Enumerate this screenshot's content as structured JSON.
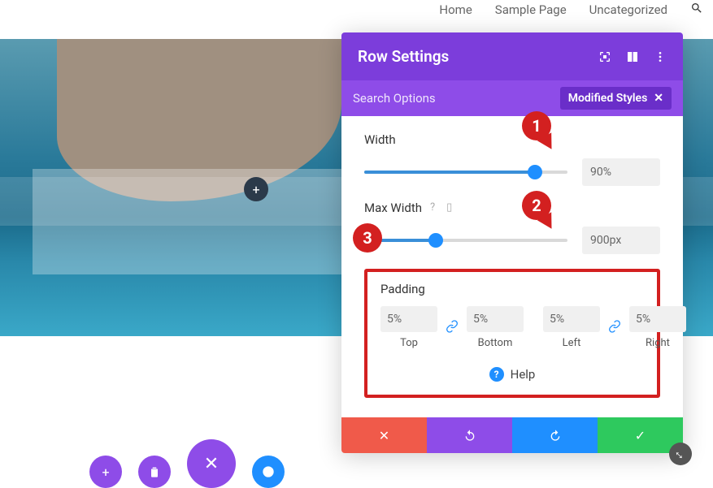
{
  "nav": {
    "items": [
      "Home",
      "Sample Page",
      "Uncategorized"
    ]
  },
  "panel": {
    "title": "Row Settings",
    "search_placeholder": "Search Options",
    "filter_label": "Modified Styles",
    "width": {
      "label": "Width",
      "value": "90%",
      "slider_percent": 84
    },
    "max_width": {
      "label": "Max Width",
      "value": "900px",
      "slider_percent": 35
    },
    "padding": {
      "label": "Padding",
      "top": {
        "value": "5%",
        "sub": "Top"
      },
      "bottom": {
        "value": "5%",
        "sub": "Bottom"
      },
      "left": {
        "value": "5%",
        "sub": "Left"
      },
      "right": {
        "value": "5%",
        "sub": "Right"
      }
    },
    "help_label": "Help"
  },
  "annotations": {
    "a1": "1",
    "a2": "2",
    "a3": "3"
  }
}
